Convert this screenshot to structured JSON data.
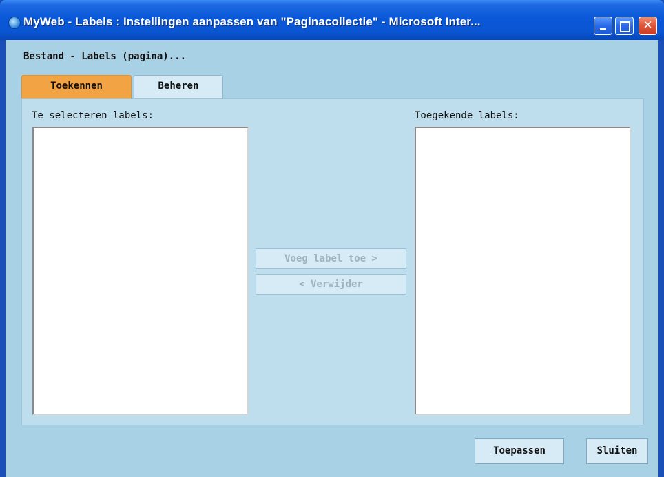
{
  "window": {
    "title": "MyWeb - Labels : Instellingen aanpassen van \"Paginacollectie\" - Microsoft Inter...",
    "icon": "ie-icon"
  },
  "header": {
    "breadcrumb": "Bestand - Labels (pagina)..."
  },
  "tabs": [
    {
      "label": "Toekennen",
      "active": true
    },
    {
      "label": "Beheren",
      "active": false
    }
  ],
  "assign": {
    "available_label": "Te selecteren labels:",
    "assigned_label": "Toegekende labels:",
    "add_button": "Voeg label toe >",
    "remove_button": "< Verwijder",
    "available_items": [],
    "assigned_items": []
  },
  "footer": {
    "apply_button": "Toepassen",
    "close_button": "Sluiten"
  },
  "colors": {
    "titlebar": "#0a58d8",
    "client_bg": "#a9d1e6",
    "active_tab": "#f2a444",
    "panel_bg": "#bfdeed"
  }
}
